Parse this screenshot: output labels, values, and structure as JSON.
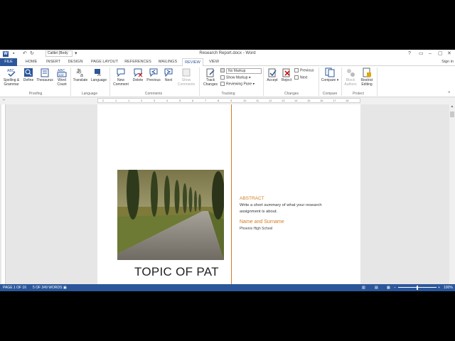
{
  "titlebar": {
    "app_icon": "W",
    "font_name": "Calibri (Body",
    "doc_title": "Research Report.docx - Word",
    "help": "?",
    "minimize": "–",
    "close": "✕"
  },
  "tabs": [
    "FILE",
    "HOME",
    "INSERT",
    "DESIGN",
    "PAGE LAYOUT",
    "REFERENCES",
    "MAILINGS",
    "REVIEW",
    "VIEW"
  ],
  "signin": "Sign in",
  "ribbon": {
    "proofing": {
      "spelling": "Spelling &",
      "grammar": "Grammar",
      "define": "Define",
      "thesaurus": "Thesaurus",
      "word": "Word",
      "count": "Count",
      "label": "Proofing",
      "abc": "ABC",
      "n123": "123"
    },
    "language": {
      "translate": "Translate",
      "language": "Language",
      "label": "Language"
    },
    "comments": {
      "new": "New",
      "comment": "Comment",
      "delete": "Delete",
      "previous": "Previous",
      "next": "Next",
      "show": "Show",
      "comments": "Comments",
      "label": "Comments"
    },
    "tracking": {
      "track": "Track",
      "changes": "Changes",
      "markup_select": "No Markup",
      "show_markup": "Show Markup",
      "reviewing_pane": "Reviewing Pane",
      "label": "Tracking"
    },
    "changes": {
      "accept": "Accept",
      "reject": "Reject",
      "previous": "Previous",
      "next": "Next",
      "label": "Changes"
    },
    "compare": {
      "compare": "Compare",
      "label": "Compare"
    },
    "protect": {
      "block": "Block",
      "authors": "Authors",
      "restrict": "Restrict",
      "editing": "Editing",
      "label": "Protect"
    }
  },
  "ruler_numbers": [
    "2",
    "1",
    "1",
    "2",
    "3",
    "4",
    "5",
    "6",
    "7",
    "8",
    "9",
    "10",
    "11",
    "12",
    "13",
    "14",
    "15",
    "16",
    "17",
    "18"
  ],
  "document": {
    "heading": "TOPIC OF PAT",
    "abstract_title": "ABSTRACT",
    "abstract_body": "Write a short summary of what your research assignment is about.",
    "name_title": "Name and Surname",
    "school": "Phoenix High School"
  },
  "statusbar": {
    "page": "PAGE 1 OF 16",
    "words": "5 OF 349 WORDS",
    "zoom": "100%"
  },
  "colors": {
    "accent": "#2b579a",
    "doc_accent": "#d47b22"
  }
}
